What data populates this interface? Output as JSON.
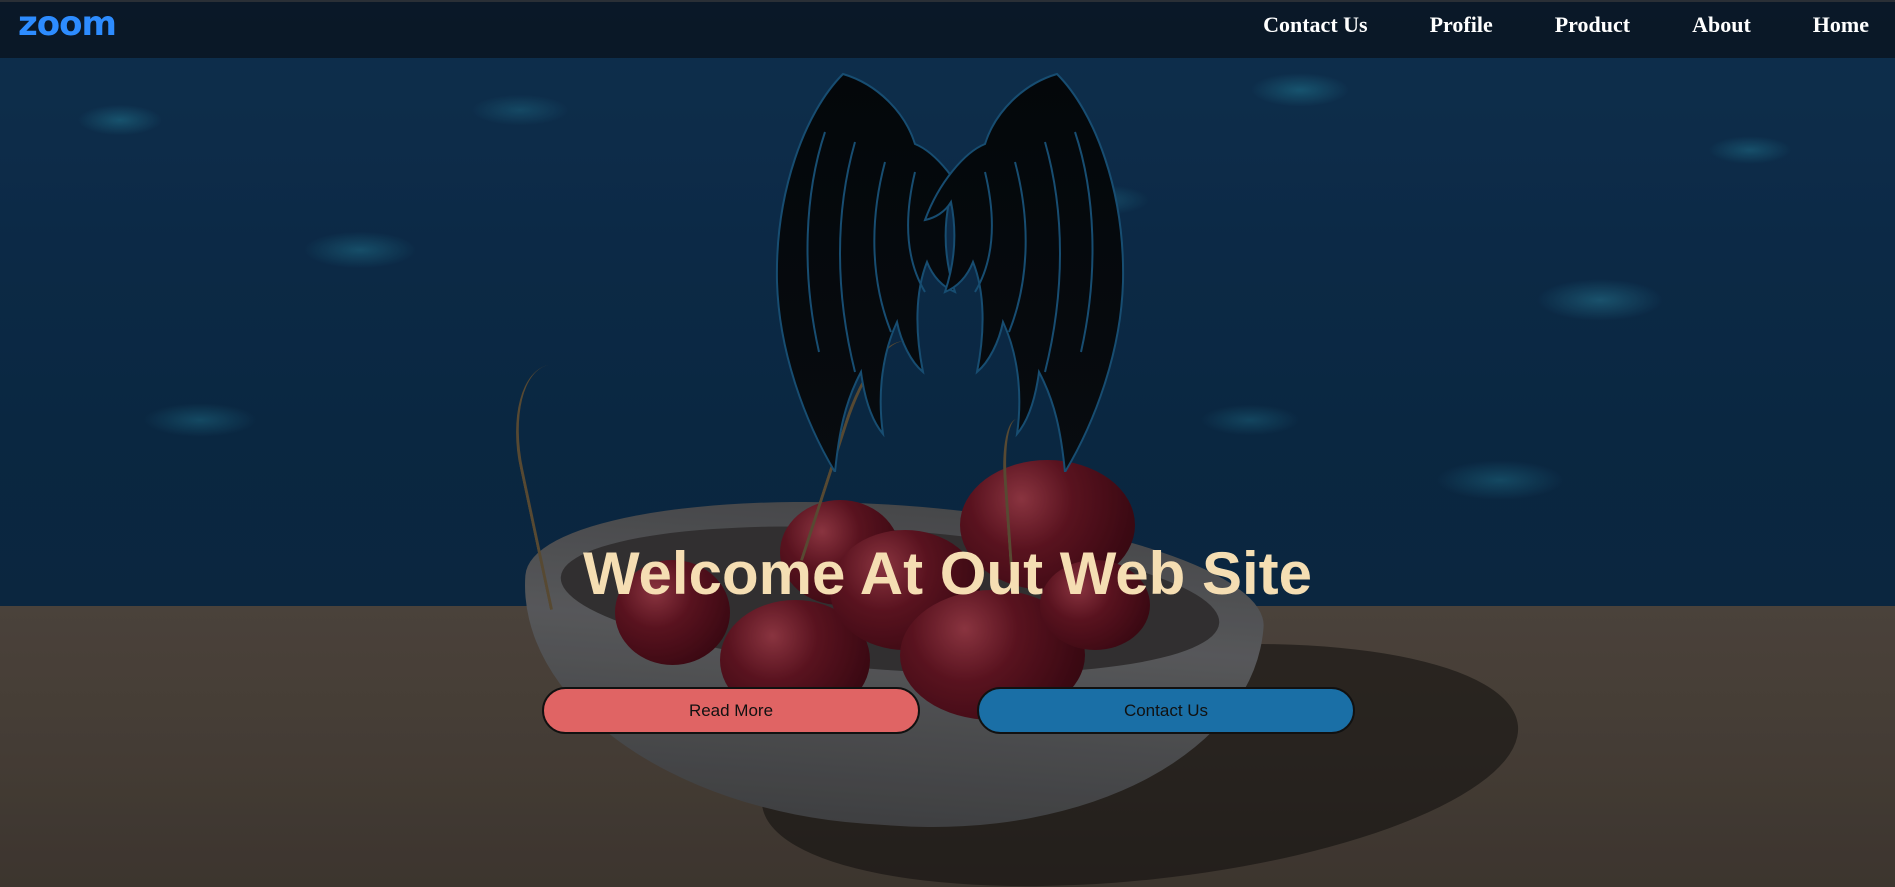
{
  "brand": {
    "logo_text": "zoom",
    "logo_color": "#2d8cff"
  },
  "nav": {
    "items": [
      {
        "label": "Contact Us"
      },
      {
        "label": "Profile"
      },
      {
        "label": "Product"
      },
      {
        "label": "About"
      },
      {
        "label": "Home"
      }
    ]
  },
  "hero": {
    "title": "Welcome At Out Web Site",
    "title_color": "#f5deb3",
    "buttons": {
      "read_more": {
        "label": "Read More",
        "color": "#e06464"
      },
      "contact_us": {
        "label": "Contact Us",
        "color": "#1a6fa6"
      }
    }
  },
  "background": {
    "description_icon": "wings-icon"
  }
}
